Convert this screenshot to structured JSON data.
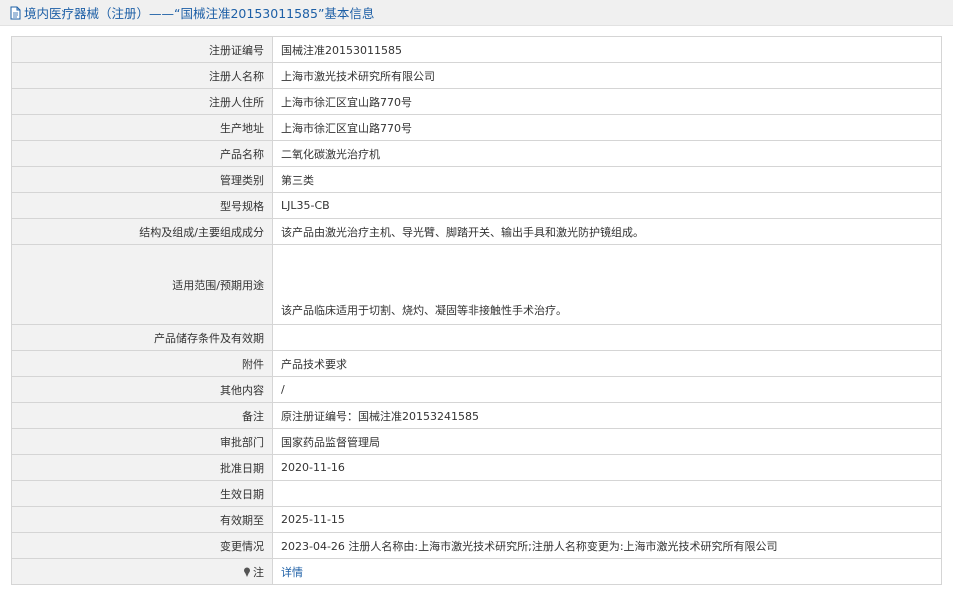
{
  "header": {
    "title": "境内医疗器械（注册）——“国械注准20153011585”基本信息",
    "icon": "document-icon"
  },
  "rows": [
    {
      "label": "注册证编号",
      "value": "国械注准20153011585"
    },
    {
      "label": "注册人名称",
      "value": "上海市激光技术研究所有限公司"
    },
    {
      "label": "注册人住所",
      "value": "上海市徐汇区宜山路770号"
    },
    {
      "label": "生产地址",
      "value": "上海市徐汇区宜山路770号"
    },
    {
      "label": "产品名称",
      "value": "二氧化碳激光治疗机"
    },
    {
      "label": "管理类别",
      "value": "第三类"
    },
    {
      "label": "型号规格",
      "value": "LJL35-CB"
    },
    {
      "label": "结构及组成/主要组成成分",
      "value": "该产品由激光治疗主机、导光臂、脚踏开关、输出手具和激光防护镜组成。"
    },
    {
      "label": "适用范围/预期用途",
      "value": "该产品临床适用于切割、烧灼、凝固等非接触性手术治疗。"
    },
    {
      "label": "产品储存条件及有效期",
      "value": ""
    },
    {
      "label": "附件",
      "value": "产品技术要求"
    },
    {
      "label": "其他内容",
      "value": "/"
    },
    {
      "label": "备注",
      "value": "原注册证编号：国械注准20153241585"
    },
    {
      "label": "审批部门",
      "value": "国家药品监督管理局"
    },
    {
      "label": "批准日期",
      "value": "2020-11-16"
    },
    {
      "label": "生效日期",
      "value": ""
    },
    {
      "label": "有效期至",
      "value": "2025-11-15"
    },
    {
      "label": "变更情况",
      "value": "2023-04-26 注册人名称由:上海市激光技术研究所;注册人名称变更为:上海市激光技术研究所有限公司"
    }
  ],
  "note_row": {
    "label": "注",
    "icon": "pin-icon",
    "link": "详情"
  },
  "colors": {
    "accent": "#1d5fa6",
    "label_bg": "#f2f2f2",
    "border": "#d5d5d5"
  }
}
